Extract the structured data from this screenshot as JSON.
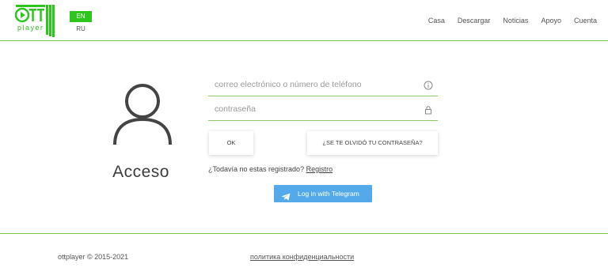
{
  "header": {
    "logo_text": "OTT player",
    "languages": {
      "active": "EN",
      "other": "RU"
    },
    "nav": [
      {
        "label": "Casa"
      },
      {
        "label": "Descargar"
      },
      {
        "label": "Noticias"
      },
      {
        "label": "Apoyo"
      },
      {
        "label": "Cuenta"
      }
    ]
  },
  "login": {
    "title": "Acceso",
    "email_placeholder": "correo electrónico o número de teléfono",
    "password_placeholder": "contraseña",
    "ok_label": "OK",
    "forgot_label": "¿SE TE OLVIDÓ TU CONTRASEÑA?",
    "register_prompt": "¿Todavía no estas registrado?",
    "register_link": "Registro",
    "telegram_label": "Log in with Telegram"
  },
  "footer": {
    "copyright": "ottplayer © 2015-2021",
    "privacy_link": "политика конфиденциальности"
  },
  "colors": {
    "accent_green": "#7ac943",
    "lang_active_bg": "#2ec51f",
    "telegram_blue": "#54a9eb"
  }
}
